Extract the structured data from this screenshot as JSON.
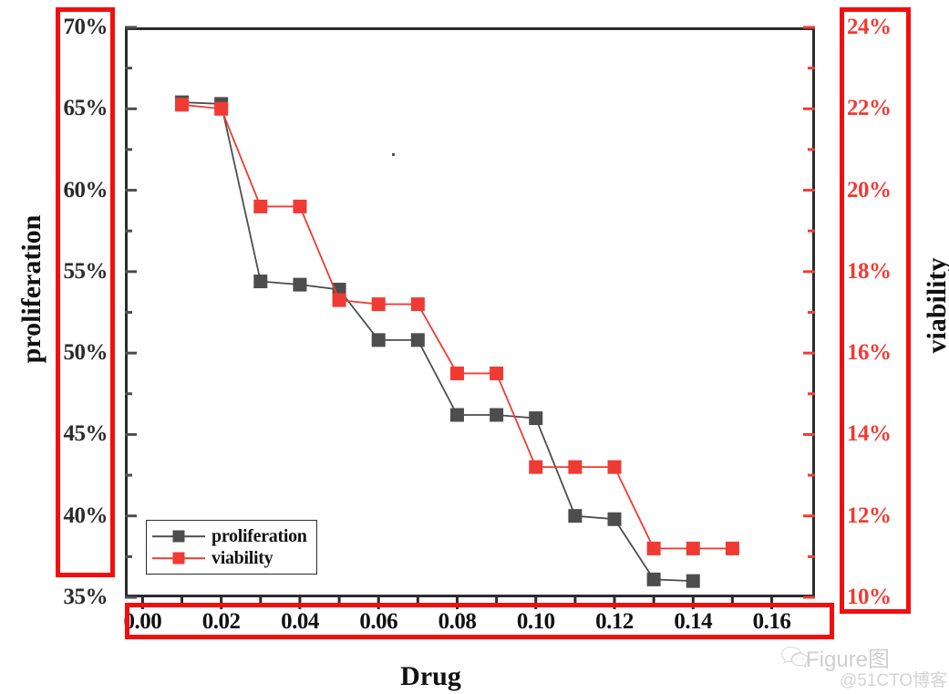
{
  "chart_data": {
    "type": "line",
    "title": "",
    "xlabel": "Drug",
    "ylabel": "proliferation",
    "y2label": "viability",
    "xlim": [
      -0.005,
      0.171
    ],
    "ylim": [
      35,
      70
    ],
    "y2lim": [
      10,
      24
    ],
    "grid": false,
    "legend_position": "lower left",
    "x": [
      0.01,
      0.02,
      0.03,
      0.04,
      0.05,
      0.06,
      0.07,
      0.08,
      0.09,
      0.1,
      0.11,
      0.12,
      0.13,
      0.14,
      0.15
    ],
    "xticks": [
      "0.00",
      "0.02",
      "0.04",
      "0.06",
      "0.08",
      "0.10",
      "0.12",
      "0.14",
      "0.16"
    ],
    "xtick_values": [
      0.0,
      0.02,
      0.04,
      0.06,
      0.08,
      0.1,
      0.12,
      0.14,
      0.16
    ],
    "yticks": [
      "35%",
      "40%",
      "45%",
      "50%",
      "55%",
      "60%",
      "65%",
      "70%"
    ],
    "ytick_values": [
      35,
      40,
      45,
      50,
      55,
      60,
      65,
      70
    ],
    "y2ticks": [
      "10%",
      "12%",
      "14%",
      "16%",
      "18%",
      "20%",
      "22%",
      "24%"
    ],
    "y2tick_values": [
      10,
      12,
      14,
      16,
      18,
      20,
      22,
      24
    ],
    "series": [
      {
        "name": "proliferation",
        "axis": "left",
        "color": "#4d4d4d",
        "marker": "square",
        "values": [
          65.4,
          65.3,
          54.4,
          54.2,
          53.9,
          50.8,
          50.8,
          46.2,
          46.2,
          46.0,
          40.0,
          39.8,
          36.1,
          36.0,
          null
        ]
      },
      {
        "name": "viability",
        "axis": "right",
        "color": "#ef3b33",
        "marker": "square",
        "values": [
          22.1,
          22.0,
          19.6,
          19.6,
          17.3,
          17.2,
          17.2,
          15.5,
          15.5,
          13.2,
          13.2,
          13.2,
          11.2,
          11.2,
          11.2
        ]
      }
    ]
  },
  "axes": {
    "left_title": "proliferation",
    "right_title": "viability",
    "bottom_title": "Drug"
  },
  "legend": {
    "items": [
      {
        "label": "proliferation",
        "color": "#4d4d4d"
      },
      {
        "label": "viability",
        "color": "#ef3b33"
      }
    ]
  },
  "watermark": {
    "icon": "wechat-icon",
    "top": "Figure图",
    "bottom": "@51CTO博客"
  },
  "colors": {
    "proliferation": "#4d4d4d",
    "viability": "#ef3b33",
    "highlight_box": "#f40d0d",
    "frame": "#2b2b2b"
  }
}
